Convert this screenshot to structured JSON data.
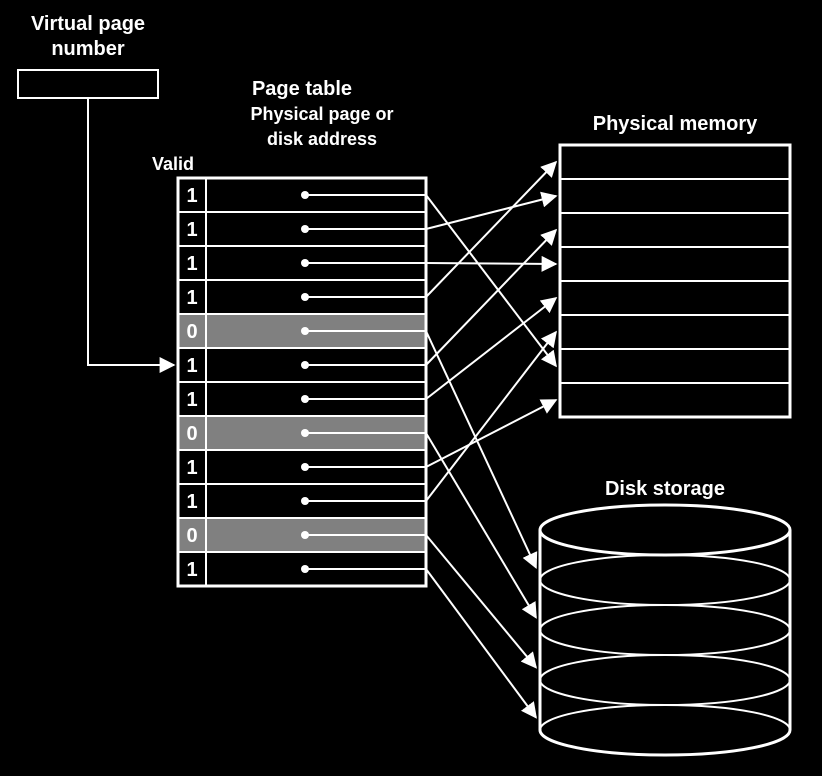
{
  "labels": {
    "vpn_line1": "Virtual page",
    "vpn_line2": "number",
    "pagetable_title": "Page table",
    "pagetable_sub1": "Physical page or",
    "pagetable_sub2": "disk address",
    "valid": "Valid",
    "physmem": "Physical memory",
    "diskstorage": "Disk storage"
  },
  "page_table": {
    "rows": [
      {
        "valid": "1",
        "shaded": false,
        "target": "mem",
        "target_slot": 6
      },
      {
        "valid": "1",
        "shaded": false,
        "target": "mem",
        "target_slot": 1
      },
      {
        "valid": "1",
        "shaded": false,
        "target": "mem",
        "target_slot": 3
      },
      {
        "valid": "1",
        "shaded": false,
        "target": "mem",
        "target_slot": 0
      },
      {
        "valid": "0",
        "shaded": true,
        "target": "disk",
        "target_slot": 0
      },
      {
        "valid": "1",
        "shaded": false,
        "target": "mem",
        "target_slot": 2
      },
      {
        "valid": "1",
        "shaded": false,
        "target": "mem",
        "target_slot": 4
      },
      {
        "valid": "0",
        "shaded": true,
        "target": "disk",
        "target_slot": 1
      },
      {
        "valid": "1",
        "shaded": false,
        "target": "mem",
        "target_slot": 7
      },
      {
        "valid": "1",
        "shaded": false,
        "target": "mem",
        "target_slot": 5
      },
      {
        "valid": "0",
        "shaded": true,
        "target": "disk",
        "target_slot": 2
      },
      {
        "valid": "1",
        "shaded": false,
        "target": "disk",
        "target_slot": 3
      }
    ]
  },
  "physical_memory": {
    "slots": 8
  },
  "disk": {
    "slots": 4
  }
}
